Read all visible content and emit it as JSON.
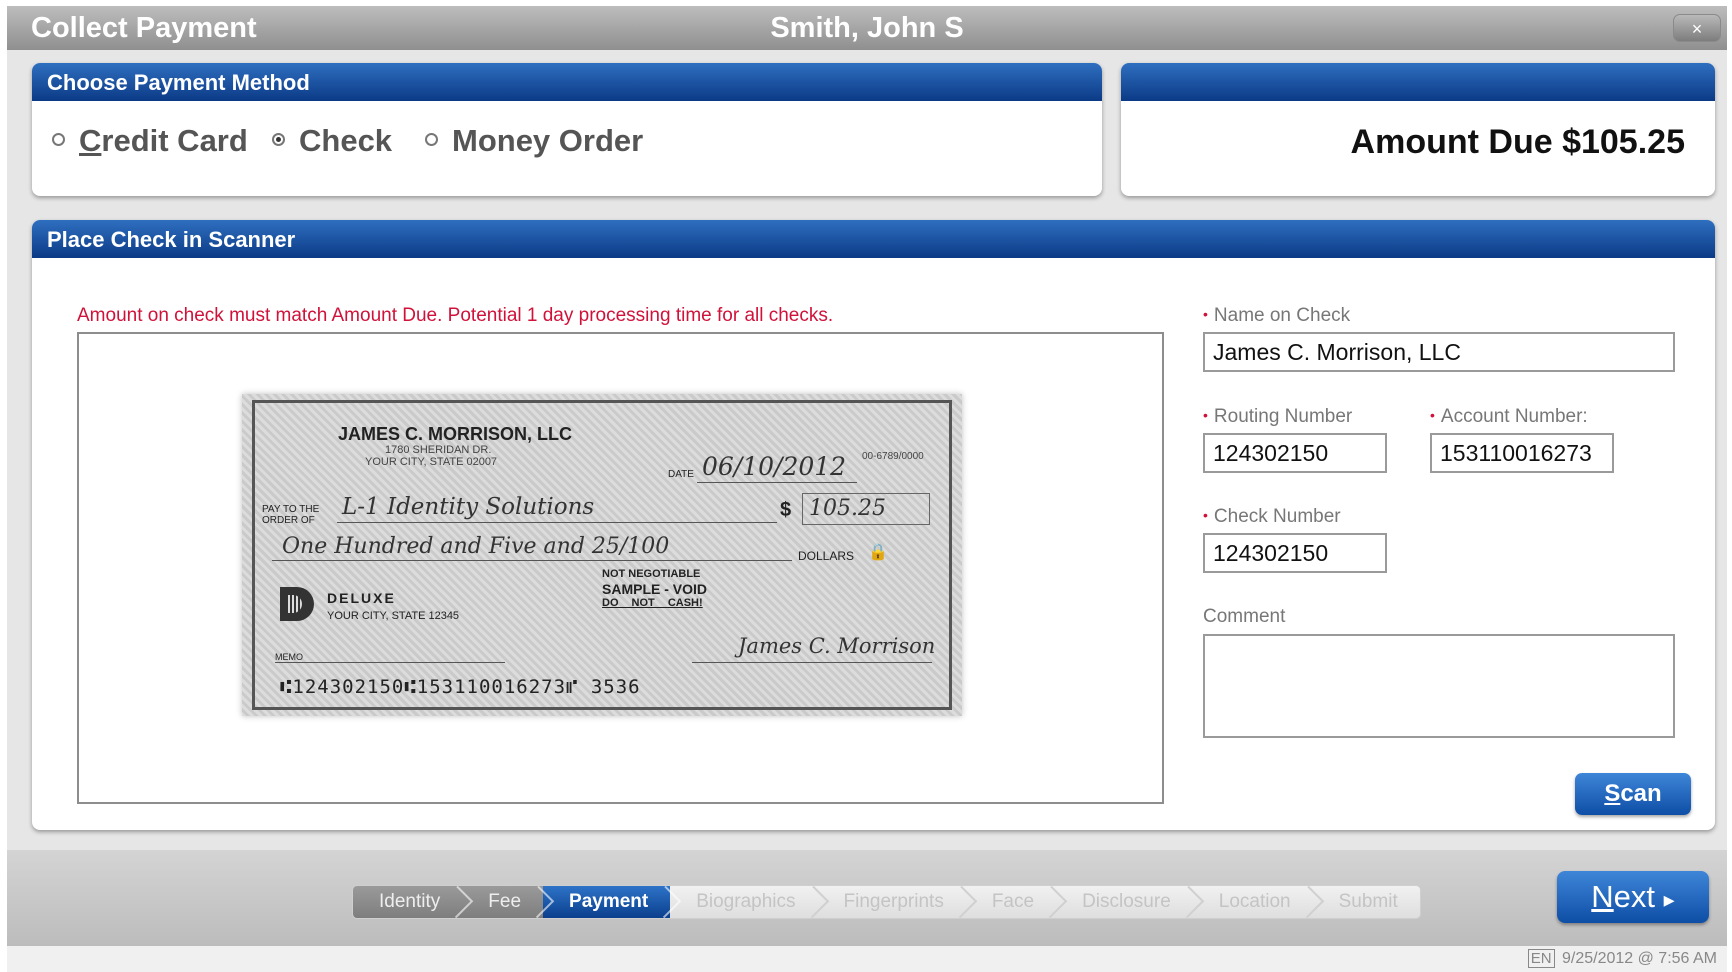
{
  "window": {
    "title": "Collect Payment",
    "patient_name": "Smith, John S",
    "close_glyph": "×"
  },
  "payment_method": {
    "header": "Choose Payment Method",
    "options": [
      {
        "label": "Credit Card",
        "selected": false
      },
      {
        "label": "Check",
        "selected": true
      },
      {
        "label": "Money Order",
        "selected": false
      }
    ]
  },
  "amount": {
    "header": "",
    "label": "Amount Due $105.25"
  },
  "scanner": {
    "header": "Place Check in Scanner",
    "warning": "Amount on check must match Amount Due. Potential 1 day processing time for all checks.",
    "check_image": {
      "payer_name": "JAMES C. MORRISON, LLC",
      "payer_address_1": "1780 SHERIDAN DR.",
      "payer_address_2": "YOUR CITY, STATE  02007",
      "date_label": "DATE",
      "date": "06/10/2012",
      "routing_fraction": "00-6789/0000",
      "pay_to_label": "PAY TO THE ORDER OF",
      "payee": "L-1 Identity Solutions",
      "dollar_sign": "$",
      "amount": "105.25",
      "written_amount": "One Hundred and Five and 25/100",
      "dollars_label": "DOLLARS",
      "bank_name": "DELUXE",
      "bank_address": "YOUR CITY, STATE 12345",
      "not_negotiable": "NOT NEGOTIABLE",
      "sample_void": "SAMPLE - VOID",
      "do_not_cash": "DO NOT CASH!",
      "memo_label": "MEMO",
      "signature": "James C. Morrison",
      "micr_line": "⑆124302150⑆153110016273⑈   3536"
    }
  },
  "form": {
    "name_label": "Name on Check",
    "name_value": "James C. Morrison, LLC",
    "routing_label": "Routing Number",
    "routing_value": "124302150",
    "account_label": "Account Number:",
    "account_value": "153110016273",
    "check_number_label": "Check Number",
    "check_number_value": "124302150",
    "comment_label": "Comment",
    "comment_value": "",
    "scan_button_first": "S",
    "scan_button_rest": "can"
  },
  "wizard": {
    "steps": [
      {
        "label": "Identity",
        "state": "done"
      },
      {
        "label": "Fee",
        "state": "done"
      },
      {
        "label": "Payment",
        "state": "current"
      },
      {
        "label": "Biographics",
        "state": "todo"
      },
      {
        "label": "Fingerprints",
        "state": "todo"
      },
      {
        "label": "Face",
        "state": "todo"
      },
      {
        "label": "Disclosure",
        "state": "todo"
      },
      {
        "label": "Location",
        "state": "todo"
      },
      {
        "label": "Submit",
        "state": "todo"
      }
    ],
    "next_first": "N",
    "next_rest": "ext",
    "next_arrow": "▸"
  },
  "status": {
    "language": "EN",
    "timestamp": "9/25/2012 @ 7:56 AM"
  },
  "colors": {
    "header_blue": "#0b3a86",
    "accent_blue": "#2d73c8",
    "warning_red": "#d0123a"
  }
}
